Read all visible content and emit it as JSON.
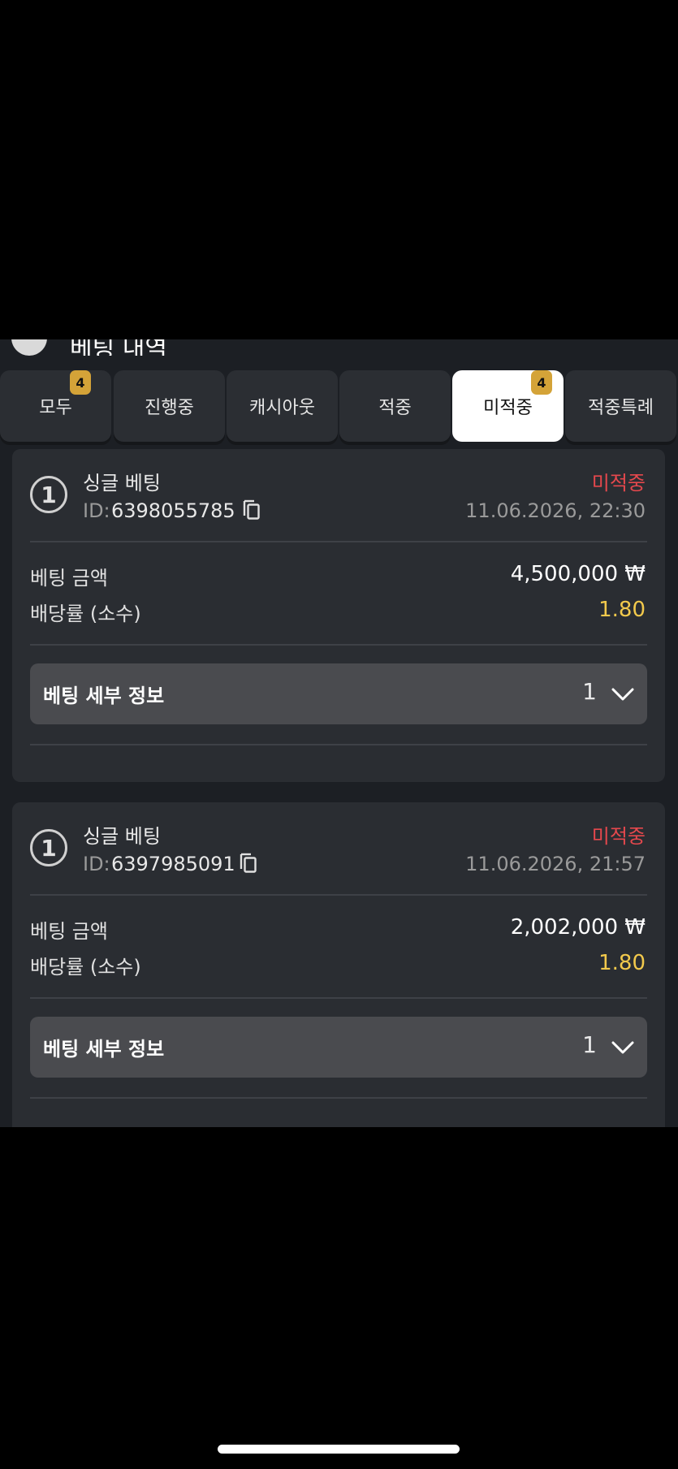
{
  "header": {
    "title": "베팅 내역"
  },
  "tabs": [
    {
      "label": "모두",
      "badge": "4",
      "active": false
    },
    {
      "label": "진행중",
      "badge": null,
      "active": false
    },
    {
      "label": "캐시아웃",
      "badge": null,
      "active": false
    },
    {
      "label": "적중",
      "badge": null,
      "active": false
    },
    {
      "label": "미적중",
      "badge": "4",
      "active": true
    },
    {
      "label": "적중특례",
      "badge": null,
      "active": false
    }
  ],
  "bets": [
    {
      "number": "1",
      "type": "싱글 베팅",
      "id_label": "ID:",
      "id": "6398055785",
      "status": "미적중",
      "datetime": "11.06.2026, 22:30",
      "amount_label": "베팅 금액",
      "amount": "4,500,000 ₩",
      "odds_label": "배당률 (소수)",
      "odds": "1.80",
      "details_label": "베팅 세부 정보",
      "details_count": "1"
    },
    {
      "number": "1",
      "type": "싱글 베팅",
      "id_label": "ID:",
      "id": "6397985091",
      "status": "미적중",
      "datetime": "11.06.2026, 21:57",
      "amount_label": "베팅 금액",
      "amount": "2,002,000 ₩",
      "odds_label": "배당률 (소수)",
      "odds": "1.80",
      "details_label": "베팅 세부 정보",
      "details_count": "1"
    }
  ],
  "icons": {
    "back": "chevron-left-icon",
    "copy": "copy-icon",
    "expand": "chevron-down-icon"
  },
  "colors": {
    "status_lost": "#e5484d",
    "odds": "#f2c94c",
    "badge": "#d4a338",
    "active_tab": "#ffffff"
  }
}
